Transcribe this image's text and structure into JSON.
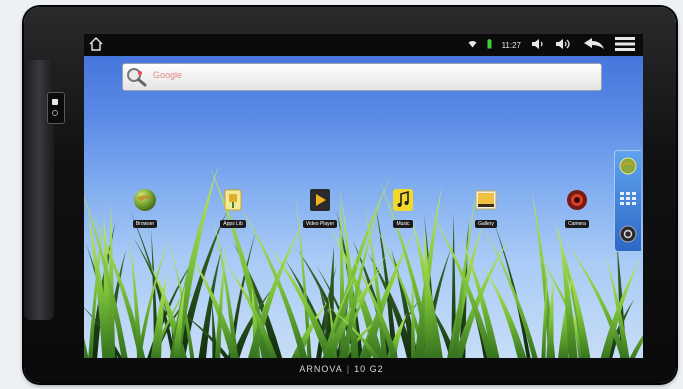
{
  "statusbar": {
    "time": "11:27"
  },
  "search": {
    "placeholder": "Google"
  },
  "apps": [
    {
      "name": "Browser",
      "icon": "globe-icon"
    },
    {
      "name": "Apps Lib",
      "icon": "apps-lib-icon"
    },
    {
      "name": "Video Player",
      "icon": "video-player-icon"
    },
    {
      "name": "Music",
      "icon": "music-icon"
    },
    {
      "name": "Gallery",
      "icon": "gallery-icon"
    },
    {
      "name": "Camera",
      "icon": "camera-icon"
    }
  ],
  "device": {
    "brand": "ARNOVA",
    "model": "10 G2"
  },
  "colors": {
    "status_bar": "#0b0b0b",
    "wallpaper_top": "#3f6fd9",
    "grass": "#7cc23a"
  }
}
